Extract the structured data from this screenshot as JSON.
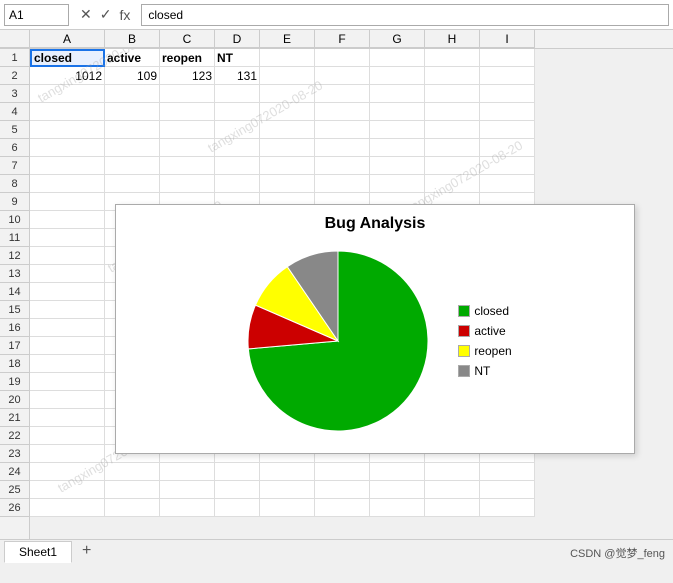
{
  "titlebar": {
    "cell_ref": "A1",
    "formula_cancel": "✕",
    "formula_confirm": "✓",
    "formula_fx": "fx",
    "formula_value": "closed"
  },
  "columns": [
    "A",
    "B",
    "C",
    "D",
    "E",
    "F",
    "G",
    "H",
    "I"
  ],
  "rows": [
    [
      "closed",
      "active",
      "reopen",
      "NT",
      "",
      "",
      "",
      "",
      ""
    ],
    [
      "1012",
      "109",
      "123",
      "131",
      "",
      "",
      "",
      "",
      ""
    ],
    [
      "",
      "",
      "",
      "",
      "",
      "",
      "",
      "",
      ""
    ],
    [
      "",
      "",
      "",
      "",
      "",
      "",
      "",
      "",
      ""
    ],
    [
      "",
      "",
      "",
      "",
      "",
      "",
      "",
      "",
      ""
    ],
    [
      "",
      "",
      "",
      "",
      "",
      "",
      "",
      "",
      ""
    ],
    [
      "",
      "",
      "",
      "",
      "",
      "",
      "",
      "",
      ""
    ],
    [
      "",
      "",
      "",
      "",
      "",
      "",
      "",
      "",
      ""
    ],
    [
      "",
      "",
      "",
      "",
      "",
      "",
      "",
      "",
      ""
    ],
    [
      "",
      "",
      "",
      "",
      "",
      "",
      "",
      "",
      ""
    ],
    [
      "",
      "",
      "",
      "",
      "",
      "",
      "",
      "",
      ""
    ],
    [
      "",
      "",
      "",
      "",
      "",
      "",
      "",
      "",
      ""
    ],
    [
      "",
      "",
      "",
      "",
      "",
      "",
      "",
      "",
      ""
    ],
    [
      "",
      "",
      "",
      "",
      "",
      "",
      "",
      "",
      ""
    ],
    [
      "",
      "",
      "",
      "",
      "",
      "",
      "",
      "",
      ""
    ],
    [
      "",
      "",
      "",
      "",
      "",
      "",
      "",
      "",
      ""
    ],
    [
      "",
      "",
      "",
      "",
      "",
      "",
      "",
      "",
      ""
    ],
    [
      "",
      "",
      "",
      "",
      "",
      "",
      "",
      "",
      ""
    ],
    [
      "",
      "",
      "",
      "",
      "",
      "",
      "",
      "",
      ""
    ],
    [
      "",
      "",
      "",
      "",
      "",
      "",
      "",
      "",
      ""
    ],
    [
      "",
      "",
      "",
      "",
      "",
      "",
      "",
      "",
      ""
    ],
    [
      "",
      "",
      "",
      "",
      "",
      "",
      "",
      "",
      ""
    ],
    [
      "",
      "",
      "",
      "",
      "",
      "",
      "",
      "",
      ""
    ],
    [
      "",
      "",
      "",
      "",
      "",
      "",
      "",
      "",
      ""
    ],
    [
      "",
      "",
      "",
      "",
      "",
      "",
      "",
      "",
      ""
    ],
    [
      "",
      "",
      "",
      "",
      "",
      "",
      "",
      "",
      ""
    ]
  ],
  "chart": {
    "title": "Bug Analysis",
    "data": [
      {
        "label": "closed",
        "value": 1012,
        "color": "#00aa00"
      },
      {
        "label": "active",
        "value": 109,
        "color": "#cc0000"
      },
      {
        "label": "reopen",
        "value": 123,
        "color": "#ffff00"
      },
      {
        "label": "NT",
        "value": 131,
        "color": "#888888"
      }
    ]
  },
  "watermark": "tangxing072020-08-20",
  "sheet": {
    "tab": "Sheet1",
    "add_label": "+"
  },
  "status": {
    "text": "CSDN @觉梦_feng"
  }
}
